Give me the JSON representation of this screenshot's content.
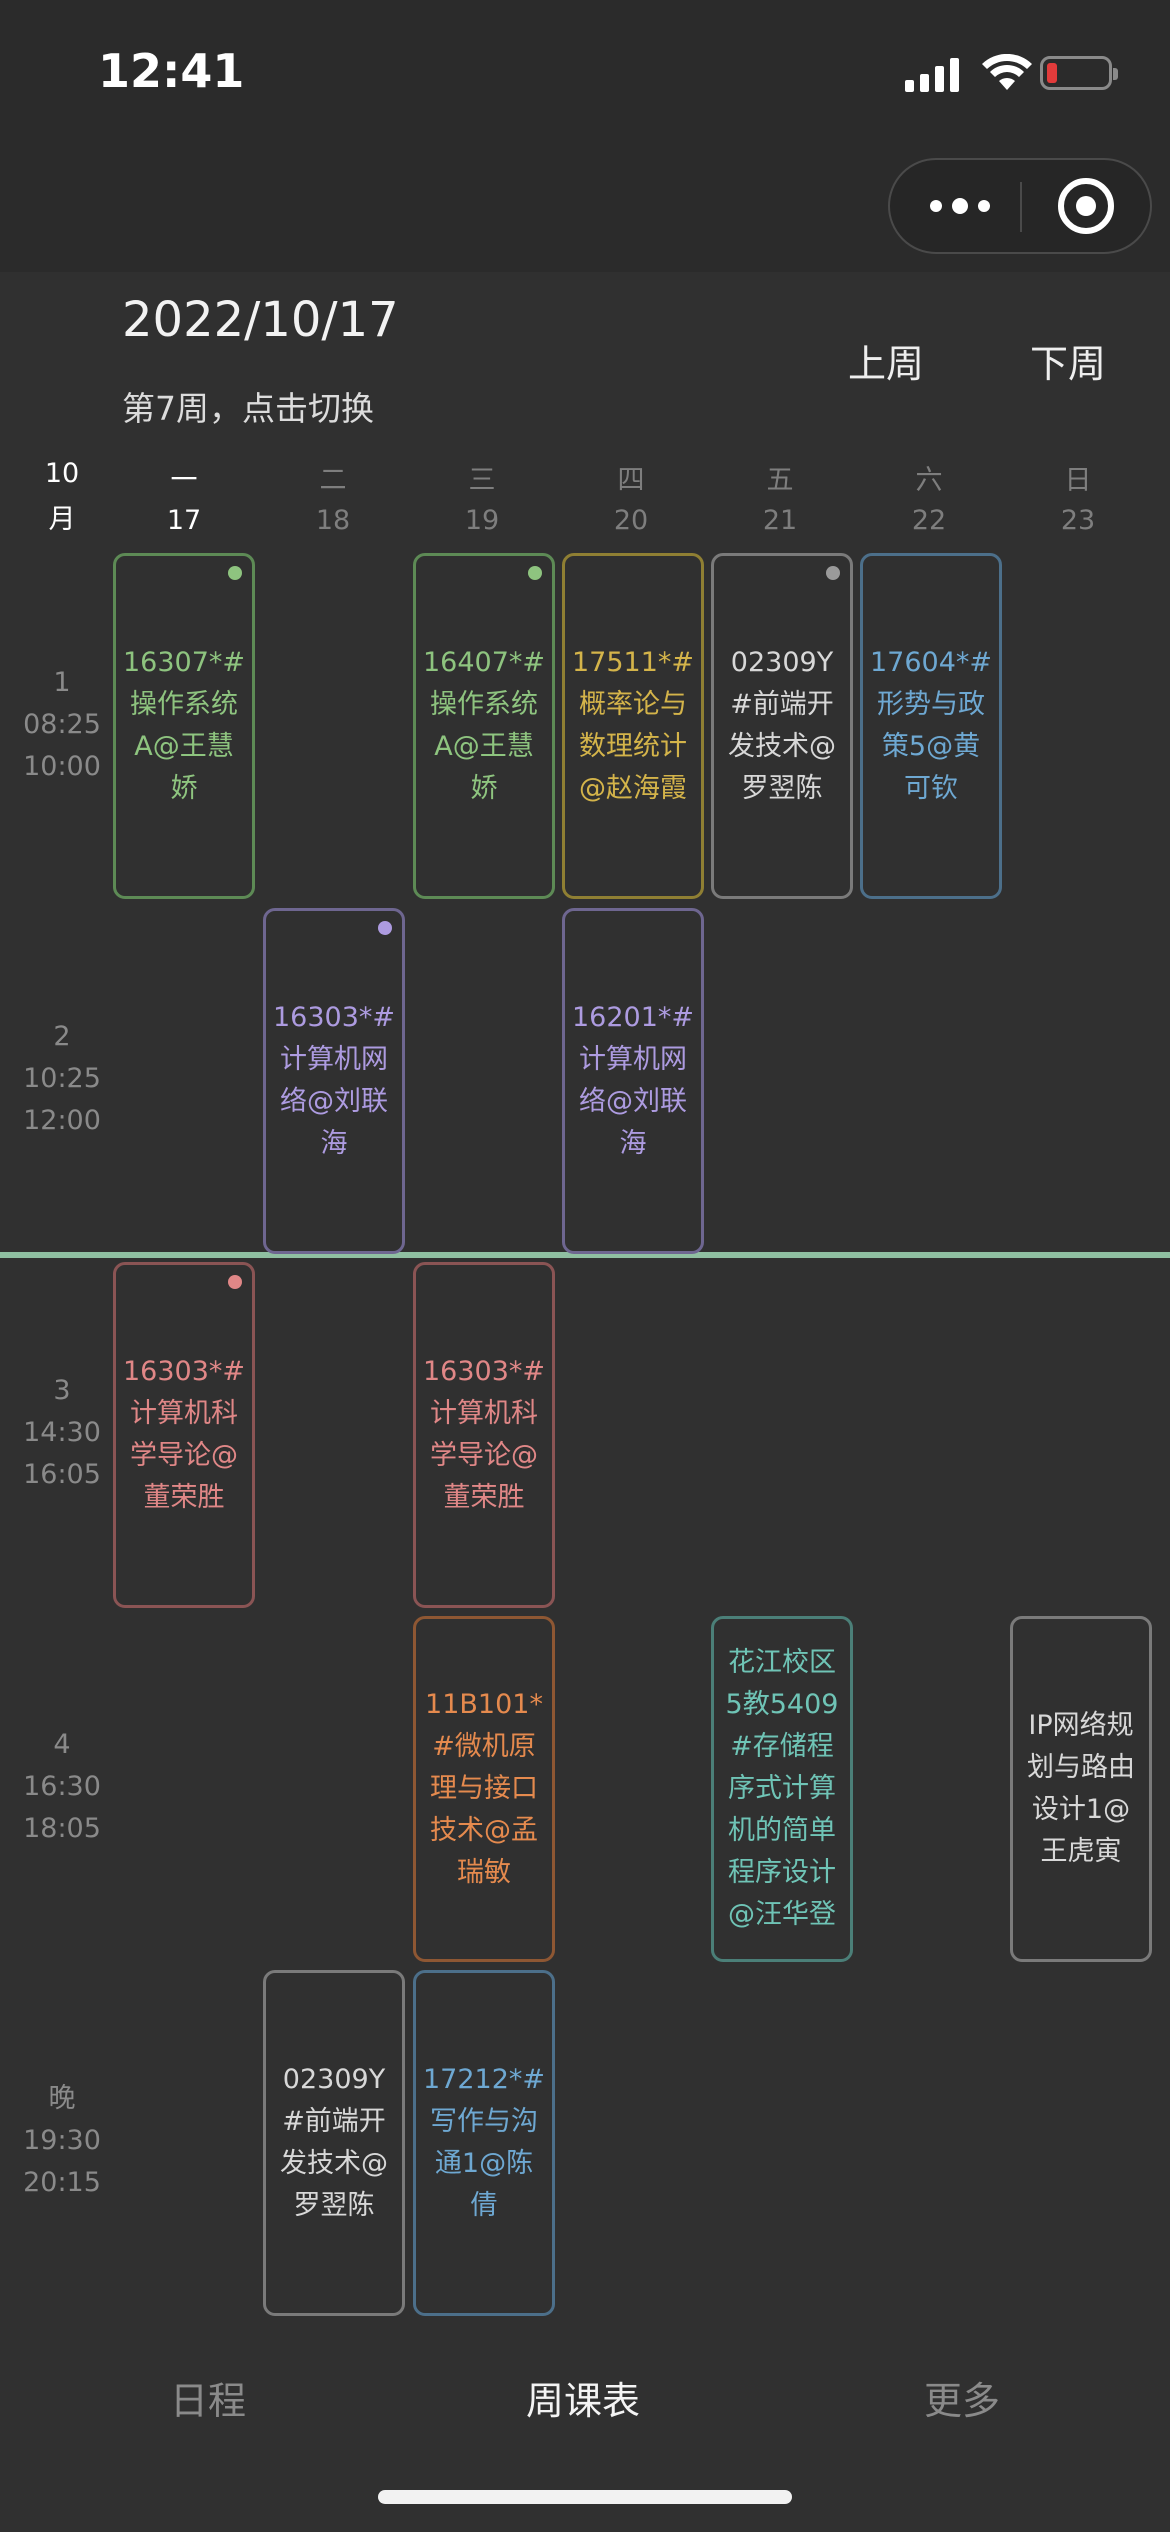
{
  "status_bar": {
    "time": "12:41"
  },
  "header": {
    "date": "2022/10/17",
    "week_label": "第7周，点击切换",
    "prev_week": "上周",
    "next_week": "下周"
  },
  "month": {
    "num": "10",
    "unit": "月"
  },
  "days": [
    {
      "weekday": "一",
      "date": "17"
    },
    {
      "weekday": "二",
      "date": "18"
    },
    {
      "weekday": "三",
      "date": "19"
    },
    {
      "weekday": "四",
      "date": "20"
    },
    {
      "weekday": "五",
      "date": "21"
    },
    {
      "weekday": "六",
      "date": "22"
    },
    {
      "weekday": "日",
      "date": "23"
    }
  ],
  "slots": [
    {
      "name": "1",
      "start": "08:25",
      "end": "10:00"
    },
    {
      "name": "2",
      "start": "10:25",
      "end": "12:00"
    },
    {
      "name": "3",
      "start": "14:30",
      "end": "16:05"
    },
    {
      "name": "4",
      "start": "16:30",
      "end": "18:05"
    },
    {
      "name": "晚",
      "start": "19:30",
      "end": "20:15"
    }
  ],
  "courses": [
    {
      "text": "16307*#操作系统A@王慧娇",
      "color": "#5d8a55",
      "text_color": "#8ec47f",
      "dot": true
    },
    {
      "text": "16407*#操作系统A@王慧娇",
      "color": "#5d8a55",
      "text_color": "#8ec47f",
      "dot": true
    },
    {
      "text": "17511*#概率论与数理统计@赵海霞",
      "color": "#8f7f33",
      "text_color": "#d4b44a",
      "dot": false
    },
    {
      "text": "02309Y#前端开发技术@罗翌陈",
      "color": "#7a7a7a",
      "text_color": "#d8d8d8",
      "dot": true
    },
    {
      "text": "17604*#形势与政策5@黄可钦",
      "color": "#4c6f8a",
      "text_color": "#6ea8d2",
      "dot": false
    },
    {
      "text": "16303*#计算机网络@刘联海",
      "color": "#6e6690",
      "text_color": "#ad9be0",
      "dot": true
    },
    {
      "text": "16201*#计算机网络@刘联海",
      "color": "#6e6690",
      "text_color": "#ad9be0",
      "dot": false
    },
    {
      "text": "16303*#计算机科学导论@董荣胜",
      "color": "#8a5454",
      "text_color": "#e08787",
      "dot": true
    },
    {
      "text": "16303*#计算机科学导论@董荣胜",
      "color": "#8a5454",
      "text_color": "#e08787",
      "dot": false
    },
    {
      "text": "11B101*#微机原理与接口技术@孟瑞敏",
      "color": "#8e5733",
      "text_color": "#e58a4e",
      "dot": false
    },
    {
      "text": "花江校区5教5409#存储程序式计算机的简单程序设计@汪华登",
      "color": "#4b7f78",
      "text_color": "#6fc4b6",
      "dot": false
    },
    {
      "text": "IP网络规划与路由设计1@王虎寅",
      "color": "#7a7a7a",
      "text_color": "#d8d8d8",
      "dot": false
    },
    {
      "text": "02309Y#前端开发技术@罗翌陈",
      "color": "#7a7a7a",
      "text_color": "#d8d8d8",
      "dot": false
    },
    {
      "text": "17212*#写作与沟通1@陈倩",
      "color": "#4c6f8a",
      "text_color": "#6ea8d2",
      "dot": false
    }
  ],
  "tabs": [
    {
      "label": "日程"
    },
    {
      "label": "周课表"
    },
    {
      "label": "更多"
    }
  ],
  "active_tab": 1
}
